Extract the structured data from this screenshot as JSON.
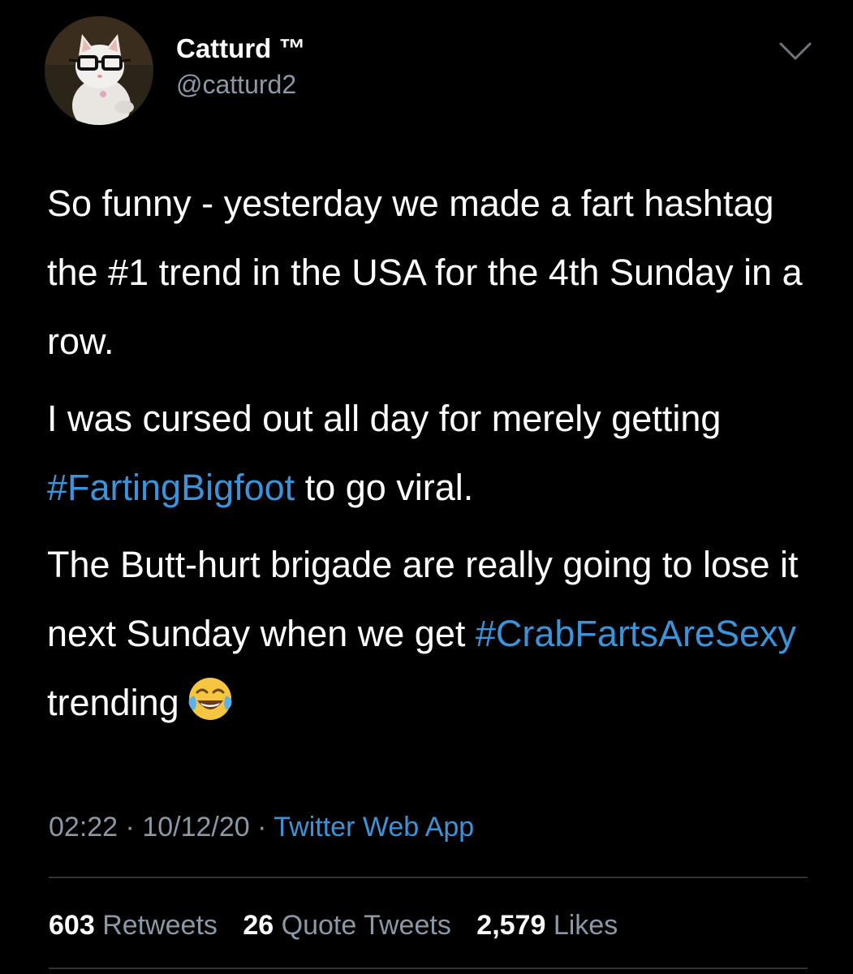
{
  "user": {
    "display_name": "Catturd ™",
    "handle": "@catturd2"
  },
  "icons": {
    "menu": "chevron-down-icon",
    "emoji": "face-with-tears-of-joy-emoji"
  },
  "tweet": {
    "p1": "So funny - yesterday we made a fart hashtag the #1 trend in the USA for the 4th Sunday in a row.",
    "p2_before": "I was cursed out all day for merely getting ",
    "p2_hashtag": "#FartingBigfoot",
    "p2_after": " to go viral.",
    "p3_before": "The Butt-hurt brigade are really going to lose it next Sunday when we get ",
    "p3_hashtag": "#CrabFartsAreSexy",
    "p3_after": " trending"
  },
  "meta": {
    "time": "02:22",
    "separator": " · ",
    "date": "10/12/20",
    "source": "Twitter Web App"
  },
  "stats": {
    "retweets_count": "603",
    "retweets_label": "Retweets",
    "quotes_count": "26",
    "quotes_label": "Quote Tweets",
    "likes_count": "2,579",
    "likes_label": "Likes"
  },
  "colors": {
    "background": "#000000",
    "text": "#ffffff",
    "secondary": "#8b98a5",
    "link": "#3b94d9",
    "divider": "#2f3336"
  }
}
